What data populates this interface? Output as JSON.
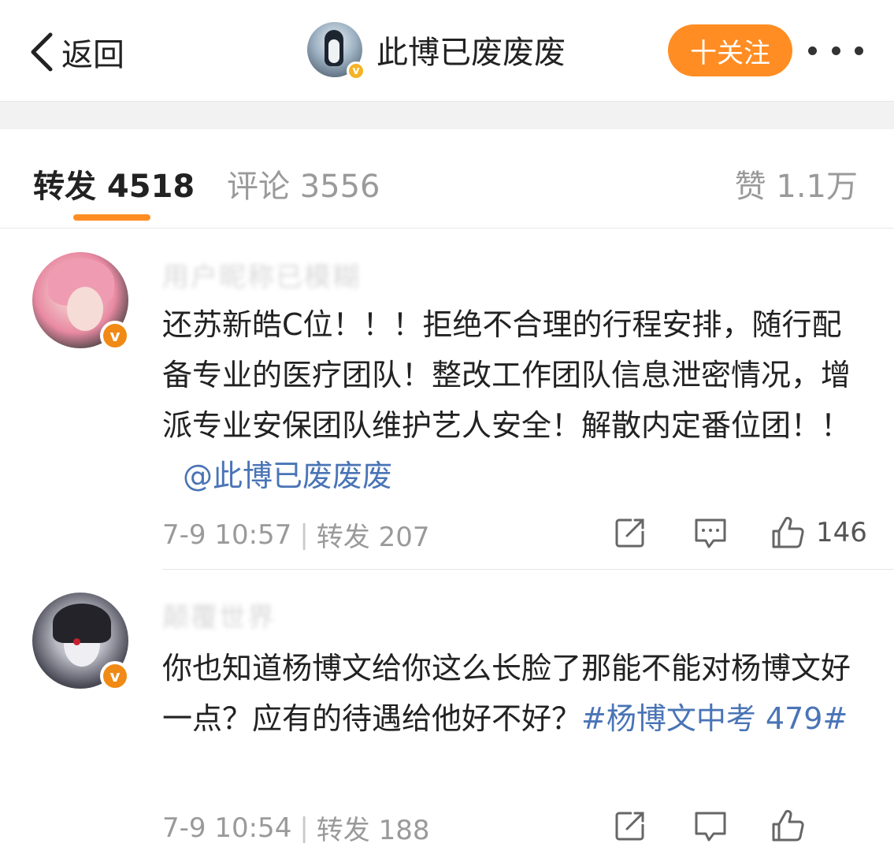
{
  "header": {
    "back_label": "返回",
    "username": "此博已废废废",
    "verify_mark": "v",
    "follow_label": "十关注"
  },
  "tabs": {
    "repost": "转发 4518",
    "comment": "评论 3556",
    "like": "赞 1.1万"
  },
  "posts": [
    {
      "nickname": "用户昵称已模糊",
      "verify_mark": "v",
      "text": "还苏新皓C位！！！拒绝不合理的行程安排，随行配备专业的医疗团队！整改工作团队信息泄密情况，增派专业安保团队维护艺人安全！解散内定番位团！！",
      "mention": "@此博已废废废",
      "time": "7-9 10:57",
      "separator": "|",
      "repost": "转发 207",
      "likes": "146"
    },
    {
      "nickname": "颠覆世界",
      "verify_mark": "v",
      "text": "你也知道杨博文给你这么长脸了那能不能对杨博文好一点？应有的待遇给他好不好？",
      "hashtag": "#杨博文中考 479#",
      "time": "7-9 10:54",
      "separator": "|",
      "repost": "转发 188"
    }
  ],
  "colors": {
    "accent": "#ff8d23",
    "link": "#4a74b6",
    "verify": "#f08a15"
  }
}
